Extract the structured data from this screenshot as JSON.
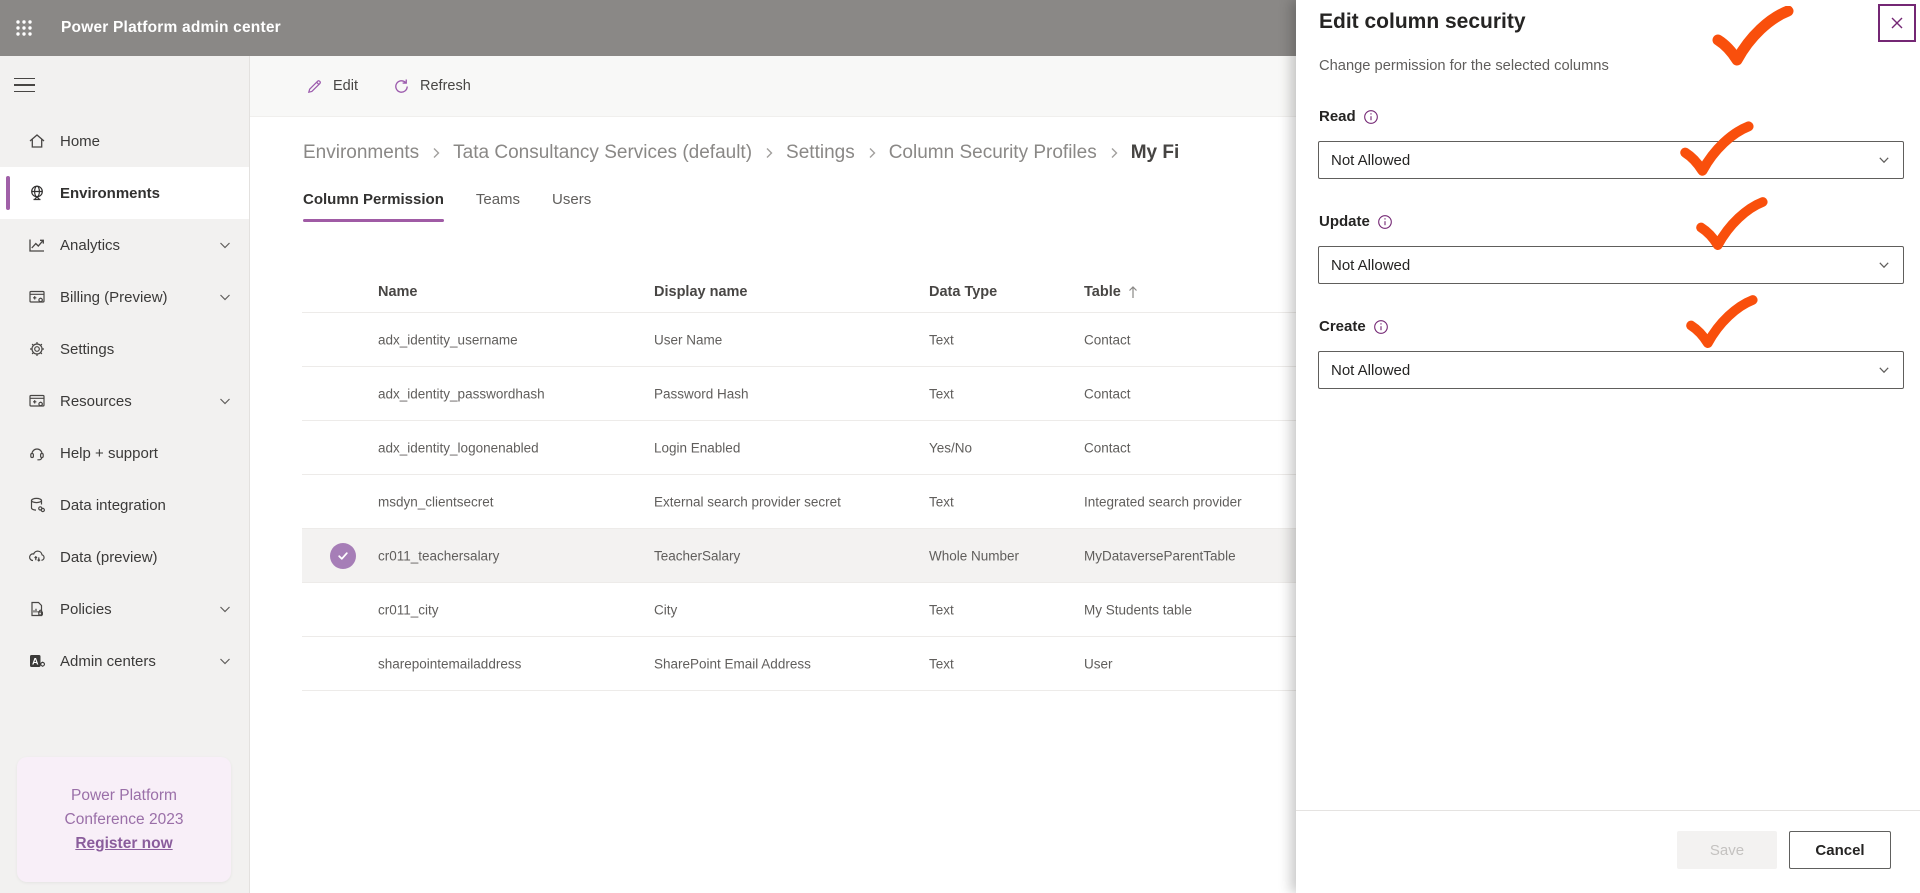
{
  "app": {
    "title": "Power Platform admin center"
  },
  "sidebar": {
    "items": [
      {
        "label": "Home",
        "icon": "home-icon",
        "selected": false,
        "expandable": false
      },
      {
        "label": "Environments",
        "icon": "globe-icon",
        "selected": true,
        "expandable": false
      },
      {
        "label": "Analytics",
        "icon": "analytics-icon",
        "selected": false,
        "expandable": true
      },
      {
        "label": "Billing (Preview)",
        "icon": "billing-icon",
        "selected": false,
        "expandable": true
      },
      {
        "label": "Settings",
        "icon": "gear-icon",
        "selected": false,
        "expandable": false
      },
      {
        "label": "Resources",
        "icon": "resources-icon",
        "selected": false,
        "expandable": true
      },
      {
        "label": "Help + support",
        "icon": "headset-icon",
        "selected": false,
        "expandable": false
      },
      {
        "label": "Data integration",
        "icon": "database-icon",
        "selected": false,
        "expandable": false
      },
      {
        "label": "Data (preview)",
        "icon": "cloud-sync-icon",
        "selected": false,
        "expandable": false
      },
      {
        "label": "Policies",
        "icon": "policies-icon",
        "selected": false,
        "expandable": true
      },
      {
        "label": "Admin centers",
        "icon": "admin-centers-icon",
        "selected": false,
        "expandable": true
      }
    ],
    "promo": {
      "line1": "Power Platform",
      "line2": "Conference 2023",
      "link": "Register now"
    }
  },
  "toolbar": {
    "edit_label": "Edit",
    "refresh_label": "Refresh"
  },
  "breadcrumb": {
    "items": [
      "Environments",
      "Tata Consultancy Services (default)",
      "Settings",
      "Column Security Profiles"
    ],
    "current": "My Fi"
  },
  "tabs": [
    {
      "label": "Column Permission",
      "active": true
    },
    {
      "label": "Teams",
      "active": false
    },
    {
      "label": "Users",
      "active": false
    }
  ],
  "table": {
    "columns": [
      "Name",
      "Display name",
      "Data Type",
      "Table"
    ],
    "sorted_column": "Table",
    "sort_direction": "ascending",
    "rows": [
      {
        "name": "adx_identity_username",
        "display_name": "User Name",
        "data_type": "Text",
        "table": "Contact",
        "selected": false
      },
      {
        "name": "adx_identity_passwordhash",
        "display_name": "Password Hash",
        "data_type": "Text",
        "table": "Contact",
        "selected": false
      },
      {
        "name": "adx_identity_logonenabled",
        "display_name": "Login Enabled",
        "data_type": "Yes/No",
        "table": "Contact",
        "selected": false
      },
      {
        "name": "msdyn_clientsecret",
        "display_name": "External search provider secret",
        "data_type": "Text",
        "table": "Integrated search provider",
        "selected": false
      },
      {
        "name": "cr011_teachersalary",
        "display_name": "TeacherSalary",
        "data_type": "Whole Number",
        "table": "MyDataverseParentTable",
        "selected": true
      },
      {
        "name": "cr011_city",
        "display_name": "City",
        "data_type": "Text",
        "table": "My Students table",
        "selected": false
      },
      {
        "name": "sharepointemailaddress",
        "display_name": "SharePoint Email Address",
        "data_type": "Text",
        "table": "User",
        "selected": false
      }
    ]
  },
  "panel": {
    "title": "Edit column security",
    "subtitle": "Change permission for the selected columns",
    "fields": [
      {
        "label": "Read",
        "value": "Not Allowed"
      },
      {
        "label": "Update",
        "value": "Not Allowed"
      },
      {
        "label": "Create",
        "value": "Not Allowed"
      }
    ],
    "save_label": "Save",
    "cancel_label": "Cancel"
  },
  "colors": {
    "topbar_bg": "#8a8886",
    "accent_purple": "#742774",
    "command_icon_purple": "#9c5bad",
    "selection_check_circle": "#a67eb7",
    "annotation_orange": "#f94f0c",
    "selected_row_bg": "#f3f2f1",
    "promo_bg": "#f8eff8",
    "promo_text": "#9a6fa8"
  }
}
